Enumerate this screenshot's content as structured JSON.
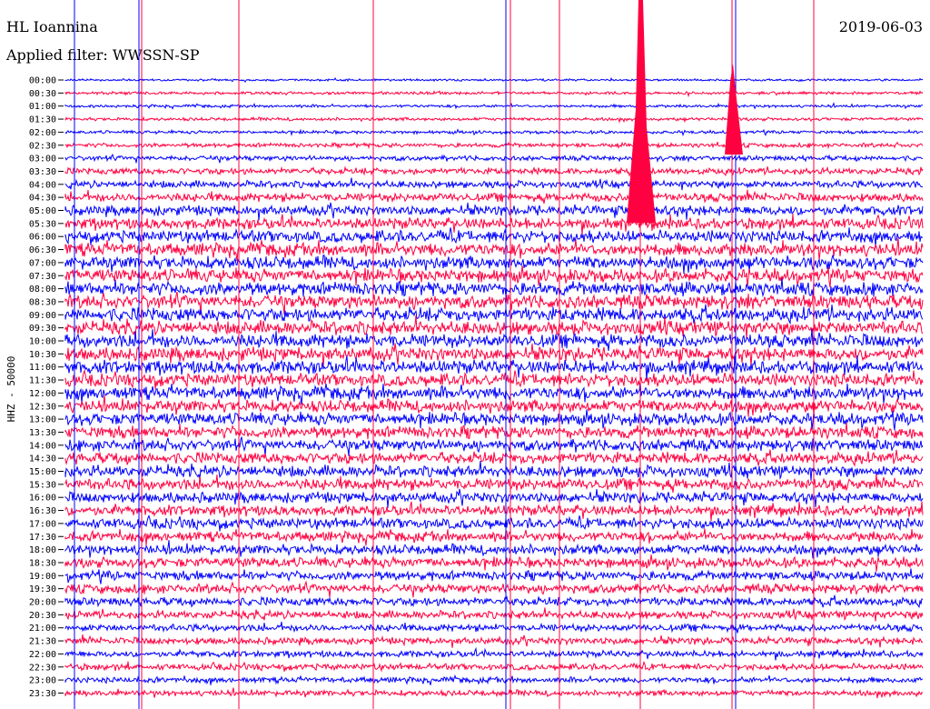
{
  "header": {
    "station": "HL Ioannina",
    "filter": "Applied filter: WWSSN-SP",
    "date": "2019-06-03"
  },
  "chart_data": {
    "type": "line",
    "channel_label": "HHZ - 50000",
    "row_labels": [
      "00:00",
      "00:30",
      "01:00",
      "01:30",
      "02:00",
      "02:30",
      "03:00",
      "03:30",
      "04:00",
      "04:30",
      "05:00",
      "05:30",
      "06:00",
      "06:30",
      "07:00",
      "07:30",
      "08:00",
      "08:30",
      "09:00",
      "09:30",
      "10:00",
      "10:30",
      "11:00",
      "11:30",
      "12:00",
      "12:30",
      "13:00",
      "13:30",
      "14:00",
      "14:30",
      "15:00",
      "15:30",
      "16:00",
      "16:30",
      "17:00",
      "17:30",
      "18:00",
      "18:30",
      "19:00",
      "19:30",
      "20:00",
      "20:30",
      "21:00",
      "21:30",
      "22:00",
      "22:30",
      "23:00",
      "23:30"
    ],
    "colors": {
      "even_rows": "#0000ff",
      "odd_rows": "#ff0040"
    },
    "row_amplitude": [
      0.15,
      0.2,
      0.2,
      0.22,
      0.22,
      0.3,
      0.35,
      0.45,
      0.5,
      0.6,
      0.7,
      0.8,
      0.85,
      0.9,
      0.9,
      0.9,
      0.95,
      0.95,
      0.95,
      0.95,
      0.95,
      0.95,
      0.95,
      0.9,
      0.9,
      0.85,
      0.85,
      0.85,
      0.8,
      0.8,
      0.8,
      0.8,
      0.75,
      0.75,
      0.75,
      0.7,
      0.7,
      0.7,
      0.65,
      0.65,
      0.6,
      0.55,
      0.5,
      0.5,
      0.45,
      0.45,
      0.4,
      0.4
    ]
  }
}
